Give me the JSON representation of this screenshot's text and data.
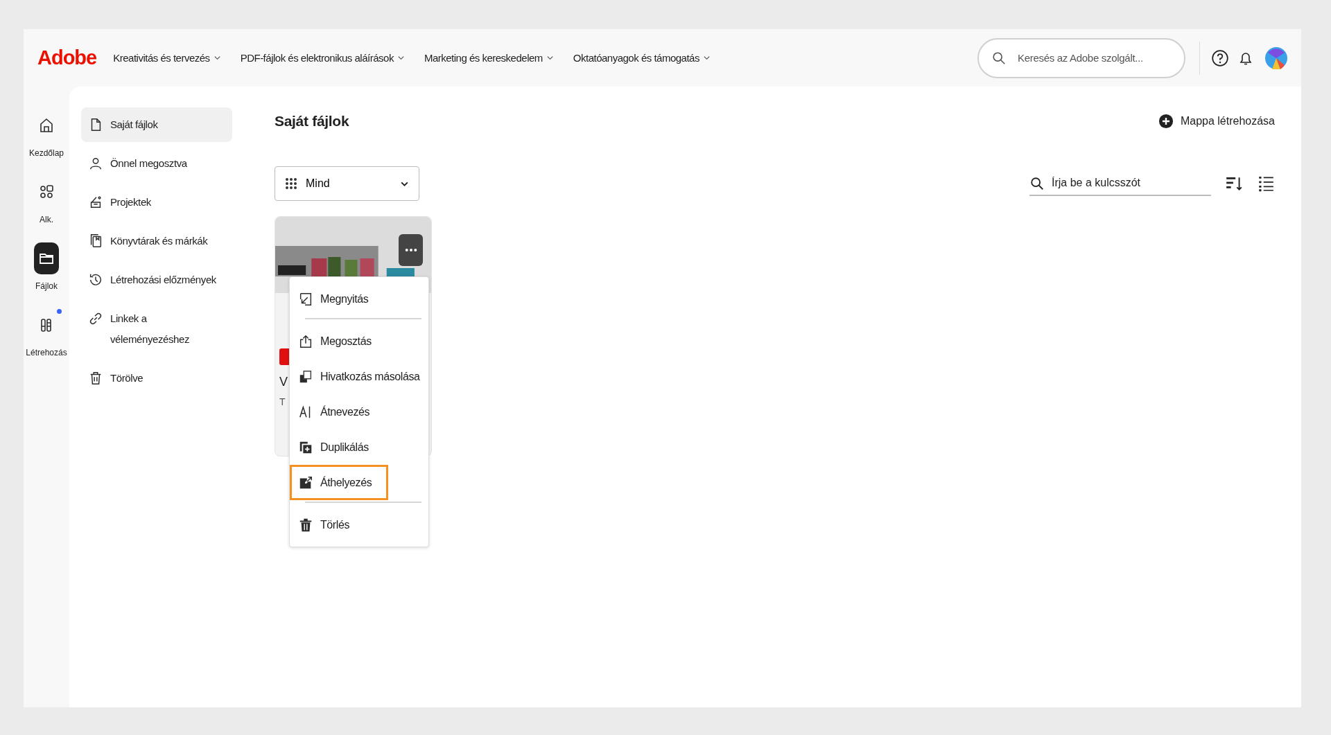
{
  "header": {
    "logo": "Adobe",
    "nav": [
      {
        "label": "Kreativitás és tervezés"
      },
      {
        "label": "PDF-fájlok és elektronikus aláírások"
      },
      {
        "label": "Marketing és kereskedelem"
      },
      {
        "label": "Oktatóanyagok és támogatás"
      }
    ],
    "search": {
      "placeholder": "Keresés az Adobe szolgált..."
    }
  },
  "rail": [
    {
      "label": "Kezdőlap",
      "selected": false,
      "badge": false
    },
    {
      "label": "Alk.",
      "selected": false,
      "badge": false
    },
    {
      "label": "Fájlok",
      "selected": true,
      "badge": false
    },
    {
      "label": "Létrehozás",
      "selected": false,
      "badge": true
    }
  ],
  "sidebar": {
    "items": [
      {
        "label": "Saját fájlok",
        "selected": true
      },
      {
        "label": "Önnel megosztva",
        "selected": false
      },
      {
        "label": "Projektek",
        "selected": false
      },
      {
        "label": "Könyvtárak és márkák",
        "selected": false
      },
      {
        "label": "Létrehozási előzmények",
        "selected": false
      },
      {
        "label": "Linkek a véleményezéshez",
        "selected": false
      },
      {
        "label": "Törölve",
        "selected": false
      }
    ]
  },
  "main": {
    "title": "Saját fájlok",
    "create_folder": "Mappa létrehozása",
    "filter": {
      "value": "Mind"
    },
    "search": {
      "placeholder": "Írja be a kulcsszót"
    },
    "card": {
      "title": "V",
      "subtitle": "T",
      "menu": [
        {
          "label": "Megnyitás",
          "highlighted": false,
          "separator_after": true
        },
        {
          "label": "Megosztás",
          "highlighted": false,
          "separator_after": false
        },
        {
          "label": "Hivatkozás másolása",
          "highlighted": false,
          "separator_after": false
        },
        {
          "label": "Átnevezés",
          "highlighted": false,
          "separator_after": false
        },
        {
          "label": "Duplikálás",
          "highlighted": false,
          "separator_after": false
        },
        {
          "label": "Áthelyezés",
          "highlighted": true,
          "separator_after": true
        },
        {
          "label": "Törlés",
          "highlighted": false,
          "separator_after": false
        }
      ]
    }
  }
}
